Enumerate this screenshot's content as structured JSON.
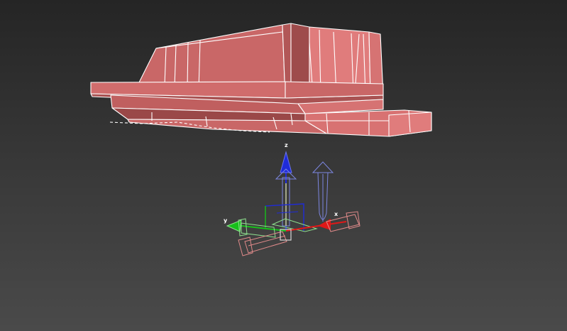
{
  "viewport": {
    "background_top": "#252525",
    "background_bottom": "#4a4a4a"
  },
  "model": {
    "fill_color": "#c96767",
    "fill_light": "#e07c7c",
    "fill_dark": "#9e4b4b",
    "edge_color": "#ffffff"
  },
  "gizmo": {
    "axis_labels": {
      "x": "x",
      "y": "y",
      "z": "z"
    },
    "colors": {
      "x": "#e01818",
      "y": "#17c01b",
      "z": "#1f2bd8",
      "z_ghost": "#7c86e0",
      "y_ghost": "#8ee08e",
      "x_ghost": "#e08a8a",
      "plane_handle": "#d8d8d8"
    },
    "icons": [
      "move-gizmo-icon",
      "x-arrow-icon",
      "y-arrow-icon",
      "z-arrow-icon"
    ]
  }
}
